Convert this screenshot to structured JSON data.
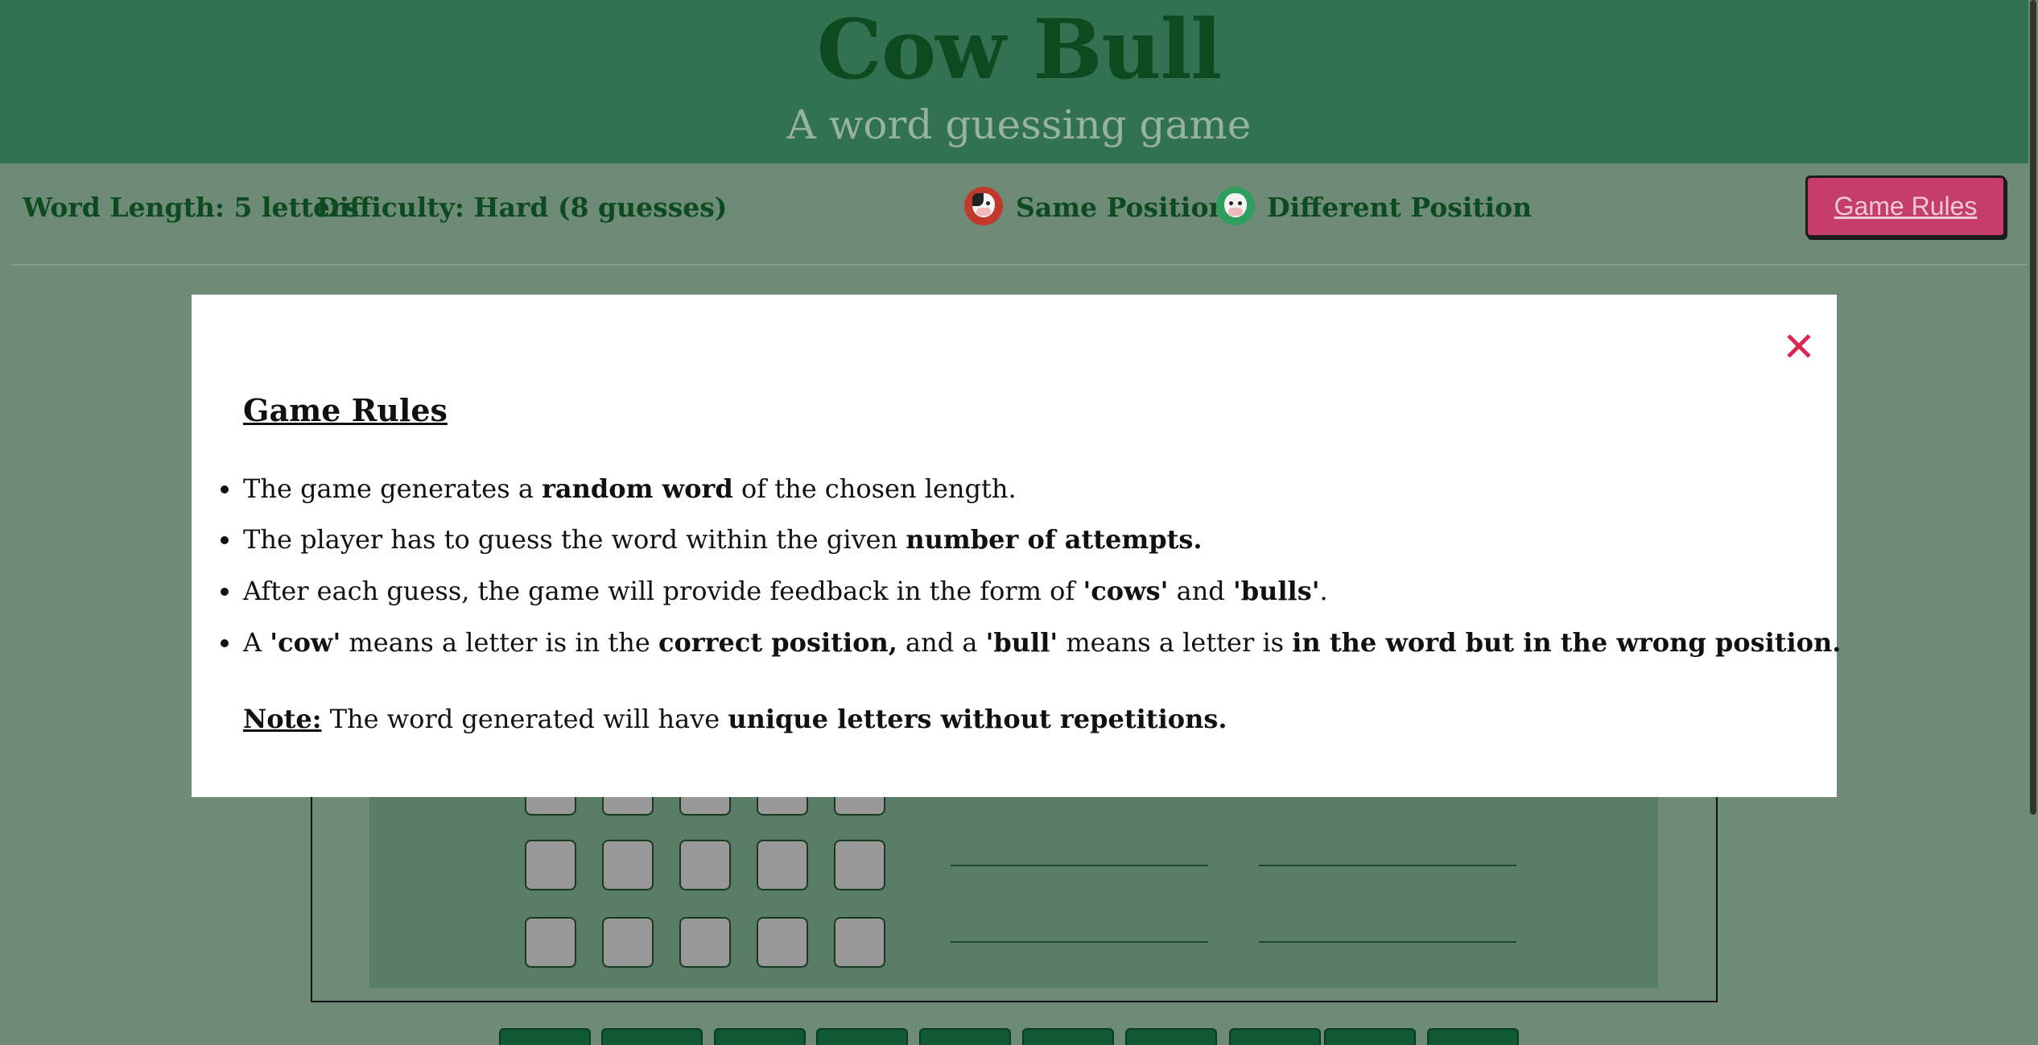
{
  "header": {
    "title": "Cow Bull",
    "subtitle": "A word guessing game"
  },
  "infobar": {
    "word_length": "Word Length: 5 letters",
    "difficulty": "Difficulty: Hard (8 guesses)",
    "legend_same": "Same Position",
    "legend_diff": "Different Position",
    "legend_same_icon": "bull-icon",
    "legend_diff_icon": "cow-icon",
    "rules_button": "Game Rules"
  },
  "modal": {
    "title": "Game Rules",
    "close_icon": "close-icon",
    "rules": [
      [
        "The game generates a ",
        "random word",
        " of the chosen length.",
        "",
        ""
      ],
      [
        "The player has to guess the word within the given ",
        "number of attempts.",
        "",
        "",
        ""
      ],
      [
        "After each guess, the game will provide feedback in the form of ",
        "'cows'",
        " and ",
        "'bulls'",
        "."
      ],
      [
        "A ",
        "'cow'",
        " means a letter is in the ",
        "correct position,",
        " and a ",
        "'bull'",
        " means a letter is ",
        "in the word but in the wrong position."
      ]
    ],
    "note_label": "Note:",
    "note_text": " The word generated will have ",
    "note_bold": "unique letters without repetitions."
  },
  "colors": {
    "header_bg": "#337153",
    "page_bg": "#6e8b78",
    "title": "#0e4a1f",
    "button": "#c53d6a",
    "close": "#dc2450",
    "cell": "#999999"
  }
}
